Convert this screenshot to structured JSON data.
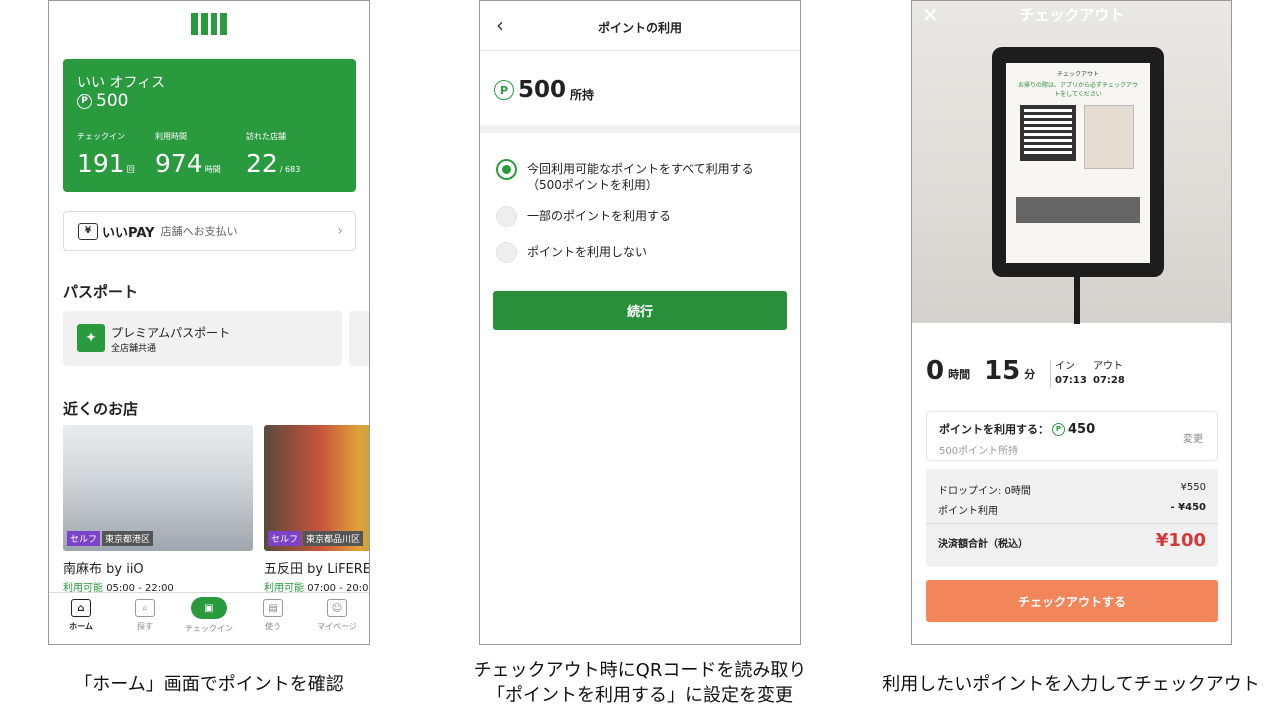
{
  "screen1": {
    "card": {
      "office": "いい オフィス",
      "points": "500",
      "stats": [
        {
          "label": "チェックイン",
          "value": "191",
          "unit": "回"
        },
        {
          "label": "利用時間",
          "value": "974",
          "unit": "時間"
        },
        {
          "label": "訪れた店舗",
          "value": "22",
          "unit": "/ 683"
        }
      ]
    },
    "pay": {
      "logo": "いいPAY",
      "text": "店舗へお支払い"
    },
    "passport_title": "パスポート",
    "passport": {
      "name": "プレミアムパスポート",
      "sub": "全店舗共通"
    },
    "nearby_title": "近くのお店",
    "shops": [
      {
        "tag1": "セルフ",
        "tag2": "東京都港区",
        "name": "南麻布 by iiO",
        "avail": "利用可能",
        "hours": "05:00 - 22:00"
      },
      {
        "tag1": "セルフ",
        "tag2": "東京都品川区",
        "name": "五反田 by LiFERE",
        "avail": "利用可能",
        "hours": "07:00 - 20:00"
      }
    ],
    "tabs": [
      "ホーム",
      "探す",
      "チェックイン",
      "使う",
      "マイページ"
    ]
  },
  "screen2": {
    "title": "ポイントの利用",
    "balance": "500",
    "balance_unit": "所持",
    "options": [
      "今回利用可能なポイントをすべて利用する（500ポイントを利用）",
      "一部のポイントを利用する",
      "ポイントを利用しない"
    ],
    "selected_option": 0,
    "continue": "続行"
  },
  "screen3": {
    "title": "チェックアウト",
    "poster": {
      "title": "チェックアウト",
      "headline": "お帰りの際は、アプリから必ずチェックアウトをしてください"
    },
    "hours": "0",
    "hours_unit": "時間",
    "minutes": "15",
    "minutes_unit": "分",
    "in_label": "イン",
    "out_label": "アウト",
    "in_time": "07:13",
    "out_time": "07:28",
    "points_use_label": "ポイントを利用する：",
    "points_use_value": "450",
    "points_held": "500ポイント所持",
    "change": "変更",
    "dropin_label": "ドロップイン: 0時間",
    "dropin_value": "¥550",
    "points_label": "ポイント利用",
    "points_value": "- ¥450",
    "total_label": "決済額合計（税込）",
    "total_value": "¥100",
    "checkout_button": "チェックアウトする"
  },
  "captions": {
    "c1": "「ホーム」画面でポイントを確認",
    "c2_line1": "チェックアウト時にQRコードを読み取り",
    "c2_line2": "「ポイントを利用する」に設定を変更",
    "c3": "利用したいポイントを入力してチェックアウト"
  },
  "colors": {
    "brand_green": "#2a9a3f",
    "checkout_orange": "#f2855a",
    "total_red": "#d03a3a",
    "tag_purple": "#7b43c8"
  }
}
